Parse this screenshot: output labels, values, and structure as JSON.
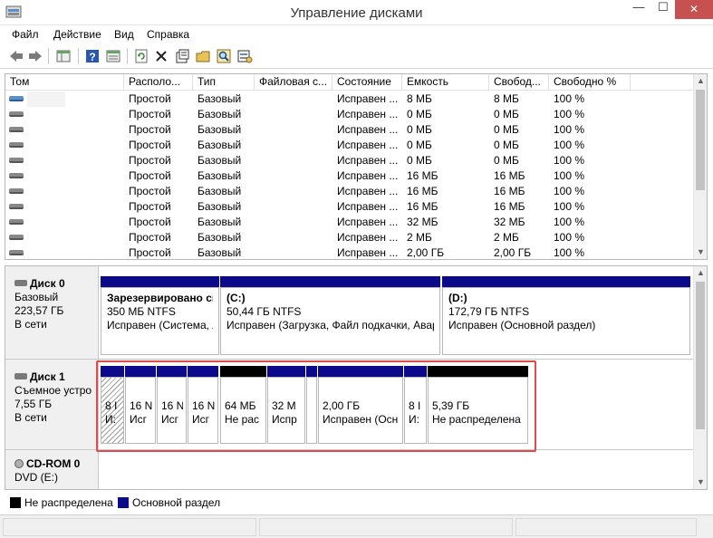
{
  "window": {
    "title": "Управление дисками",
    "minimize_glyph": "—",
    "maximize_glyph": "☐",
    "close_glyph": "✕"
  },
  "menu": [
    "Файл",
    "Действие",
    "Вид",
    "Справка"
  ],
  "toolbar_icons": [
    "back-icon",
    "forward-icon",
    "console-tree-icon",
    "help-icon",
    "properties-view-icon",
    "refresh-icon",
    "delete-icon",
    "properties-icon",
    "open-icon",
    "search-icon",
    "wizard-icon"
  ],
  "volume_table": {
    "columns": [
      "Том",
      "Располо...",
      "Тип",
      "Файловая с...",
      "Состояние",
      "Емкость",
      "Свобод...",
      "Свободно %"
    ],
    "rows": [
      {
        "vol": "",
        "layout": "Простой",
        "type": "Базовый",
        "fs": "",
        "state": "Исправен ...",
        "cap": "8 МБ",
        "free": "8 МБ",
        "pct": "100 %"
      },
      {
        "vol": "",
        "layout": "Простой",
        "type": "Базовый",
        "fs": "",
        "state": "Исправен ...",
        "cap": "0 МБ",
        "free": "0 МБ",
        "pct": "100 %"
      },
      {
        "vol": "",
        "layout": "Простой",
        "type": "Базовый",
        "fs": "",
        "state": "Исправен ...",
        "cap": "0 МБ",
        "free": "0 МБ",
        "pct": "100 %"
      },
      {
        "vol": "",
        "layout": "Простой",
        "type": "Базовый",
        "fs": "",
        "state": "Исправен ...",
        "cap": "0 МБ",
        "free": "0 МБ",
        "pct": "100 %"
      },
      {
        "vol": "",
        "layout": "Простой",
        "type": "Базовый",
        "fs": "",
        "state": "Исправен ...",
        "cap": "0 МБ",
        "free": "0 МБ",
        "pct": "100 %"
      },
      {
        "vol": "",
        "layout": "Простой",
        "type": "Базовый",
        "fs": "",
        "state": "Исправен ...",
        "cap": "16 МБ",
        "free": "16 МБ",
        "pct": "100 %"
      },
      {
        "vol": "",
        "layout": "Простой",
        "type": "Базовый",
        "fs": "",
        "state": "Исправен ...",
        "cap": "16 МБ",
        "free": "16 МБ",
        "pct": "100 %"
      },
      {
        "vol": "",
        "layout": "Простой",
        "type": "Базовый",
        "fs": "",
        "state": "Исправен ...",
        "cap": "16 МБ",
        "free": "16 МБ",
        "pct": "100 %"
      },
      {
        "vol": "",
        "layout": "Простой",
        "type": "Базовый",
        "fs": "",
        "state": "Исправен ...",
        "cap": "32 МБ",
        "free": "32 МБ",
        "pct": "100 %"
      },
      {
        "vol": "",
        "layout": "Простой",
        "type": "Базовый",
        "fs": "",
        "state": "Исправен ...",
        "cap": "2 МБ",
        "free": "2 МБ",
        "pct": "100 %"
      },
      {
        "vol": "",
        "layout": "Простой",
        "type": "Базовый",
        "fs": "",
        "state": "Исправен ...",
        "cap": "2,00 ГБ",
        "free": "2,00 ГБ",
        "pct": "100 %"
      }
    ]
  },
  "disks": {
    "disk0": {
      "name": "Диск 0",
      "type": "Базовый",
      "size": "223,57 ГБ",
      "status": "В сети",
      "partitions": [
        {
          "title": "Зарезервировано си",
          "line1": "350 МБ NTFS",
          "line2": "Исправен (Система, А"
        },
        {
          "title": "(C:)",
          "line1": "50,44 ГБ NTFS",
          "line2": "Исправен (Загрузка, Файл подкачки, Авар"
        },
        {
          "title": "(D:)",
          "line1": "172,79 ГБ NTFS",
          "line2": "Исправен (Основной раздел)"
        }
      ]
    },
    "disk1": {
      "name": "Диск 1",
      "type": "Съемное устро",
      "size": "7,55 ГБ",
      "status": "В сети",
      "partitions": [
        {
          "line1": "8 I",
          "line2": "И:"
        },
        {
          "line1": "16 N",
          "line2": "Исг"
        },
        {
          "line1": "16 N",
          "line2": "Исг"
        },
        {
          "line1": "16 N",
          "line2": "Исг"
        },
        {
          "line1": "64 МБ",
          "line2": "Не рас"
        },
        {
          "line1": "32 М",
          "line2": "Испр"
        },
        {
          "line1": "",
          "line2": ""
        },
        {
          "line1": "2,00 ГБ",
          "line2": "Исправен (Осн"
        },
        {
          "line1": "8 I",
          "line2": "И:"
        },
        {
          "line1": "5,39 ГБ",
          "line2": "Не распределена"
        }
      ]
    },
    "cdrom": {
      "name": "CD-ROM 0",
      "type": "DVD (E:)"
    }
  },
  "legend": {
    "unallocated": "Не распределена",
    "primary": "Основной раздел",
    "unallocated_color": "#000000",
    "primary_color": "#0a0a8a"
  }
}
